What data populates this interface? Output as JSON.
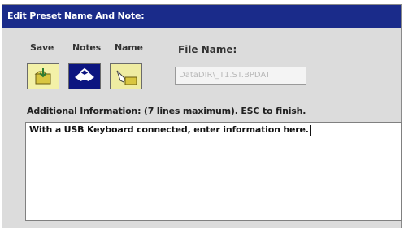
{
  "window": {
    "title": "Edit Preset Name And Note:"
  },
  "toolbar": {
    "save_label": "Save",
    "notes_label": "Notes",
    "name_label": "Name"
  },
  "file_name": {
    "label": "File Name:",
    "value": "DataDIR\\_T1.ST.BPDAT"
  },
  "additional_info": {
    "label": "Additional Information: (7 lines maximum). ESC to finish.",
    "text": "With a USB Keyboard connected, enter information here."
  },
  "colors": {
    "title_bar": "#1a2b8a",
    "notes_button_active": "#0c1580",
    "button_inactive": "#f3f1a8"
  },
  "icons": {
    "save": "save-folder-icon",
    "notes": "notes-hands-icon",
    "name": "name-edit-icon"
  }
}
